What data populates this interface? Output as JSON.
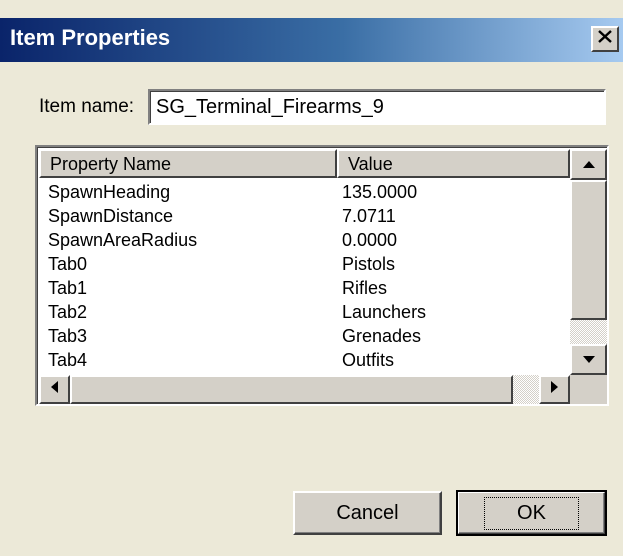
{
  "window": {
    "title": "Item Properties",
    "close_glyph": "close-icon"
  },
  "item_name": {
    "label": "Item name:",
    "value": "SG_Terminal_Firearms_9"
  },
  "properties": {
    "columns": [
      "Property Name",
      "Value"
    ],
    "rows": [
      {
        "name": "SpawnHeading",
        "value": "135.0000"
      },
      {
        "name": "SpawnDistance",
        "value": "7.0711"
      },
      {
        "name": "SpawnAreaRadius",
        "value": "0.0000"
      },
      {
        "name": "Tab0",
        "value": "Pistols"
      },
      {
        "name": "Tab1",
        "value": "Rifles"
      },
      {
        "name": "Tab2",
        "value": "Launchers"
      },
      {
        "name": "Tab3",
        "value": "Grenades"
      },
      {
        "name": "Tab4",
        "value": "Outfits"
      }
    ]
  },
  "buttons": {
    "cancel": "Cancel",
    "ok": "OK"
  }
}
